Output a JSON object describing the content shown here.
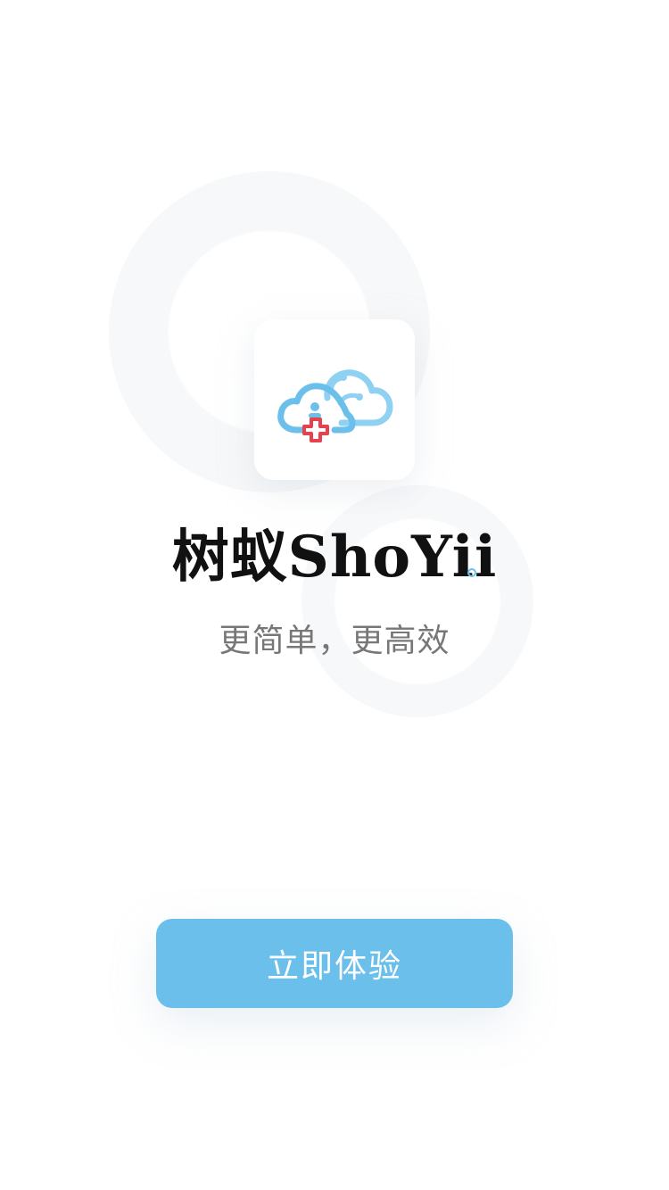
{
  "app": {
    "name": "树蚁ShoYii",
    "tagline": "更简单，更高效"
  },
  "logo": {
    "icon": "cloud-medical-logo-icon",
    "primary_color": "#6bbfeb",
    "light_color": "#8fd1f2",
    "accent_color": "#e5424d"
  },
  "actions": {
    "start_label": "立即体验"
  },
  "colors": {
    "background": "#ffffff",
    "button": "#6bbfeb",
    "title": "#111111",
    "tagline": "#777777"
  }
}
